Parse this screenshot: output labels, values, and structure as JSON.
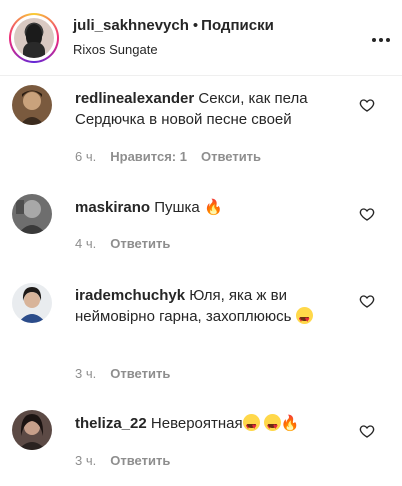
{
  "header": {
    "username": "juli_sakhnevych",
    "separator": "•",
    "follow_label": "Подписки",
    "location": "Rixos Sungate",
    "more_icon": "more-horizontal-icon"
  },
  "comments": [
    {
      "username": "redlinealexander",
      "text": "Секси, как пела Сердючка в новой песне своей",
      "time": "6 ч.",
      "likes": "Нравится: 1",
      "reply": "Ответить"
    },
    {
      "username": "maskirano",
      "text": "Пушка",
      "emoji": "🔥",
      "time": "4 ч.",
      "reply": "Ответить"
    },
    {
      "username": "irademchuchyk",
      "text": "Юля, яка ж ви неймовірно гарна, захоплююсь",
      "emoji": "😍",
      "time": "3 ч.",
      "reply": "Ответить"
    },
    {
      "username": "theliza_22",
      "text": "Невероятная",
      "emoji": "🔥",
      "time": "3 ч.",
      "reply": "Ответить"
    }
  ],
  "colors": {
    "text": "#262626",
    "secondary": "#8e8e8e",
    "fire": "#f5641f",
    "heart_eyes": "#ffd84a"
  }
}
